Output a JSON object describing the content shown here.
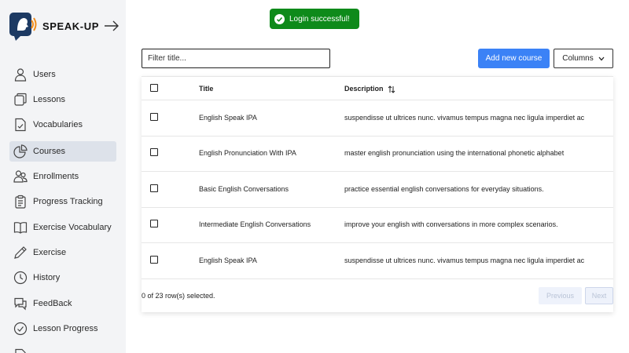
{
  "app": {
    "brand_name": "SPEAK-UP",
    "accent_color": "#3b82f6",
    "toast_color": "#0e8a1a"
  },
  "sidebar": {
    "items": [
      {
        "label": "Users",
        "icon": "user-icon"
      },
      {
        "label": "Lessons",
        "icon": "lessons-icon"
      },
      {
        "label": "Vocabularies",
        "icon": "document-check-icon"
      },
      {
        "label": "Courses",
        "icon": "pie-chart-icon",
        "active": true
      },
      {
        "label": "Enrollments",
        "icon": "users-icon"
      },
      {
        "label": "Progress Tracking",
        "icon": "clipboard-icon"
      },
      {
        "label": "Exercise Vocabulary",
        "icon": "book-icon"
      },
      {
        "label": "Exercise",
        "icon": "pencil-icon"
      },
      {
        "label": "History",
        "icon": "clock-icon"
      },
      {
        "label": "FeedBack",
        "icon": "chat-icon"
      },
      {
        "label": "Lesson Progress",
        "icon": "check-circle-icon"
      }
    ]
  },
  "toast": {
    "message": "Login successful!",
    "icon": "check-circle-icon"
  },
  "toolbar": {
    "filter_placeholder": "Filter title...",
    "filter_value": "",
    "add_label": "Add new course",
    "columns_label": "Columns"
  },
  "table": {
    "columns": [
      "Title",
      "Description"
    ],
    "rows": [
      {
        "title": "English Speak IPA",
        "description": "suspendisse ut ultrices nunc. vivamus tempus magna nec ligula imperdiet ac"
      },
      {
        "title": "English Pronunciation With IPA",
        "description": "master english pronunciation using the international phonetic alphabet"
      },
      {
        "title": "Basic English Conversations",
        "description": "practice essential english conversations for everyday situations."
      },
      {
        "title": "Intermediate English Conversations",
        "description": "improve your english with conversations in more complex scenarios."
      },
      {
        "title": "English Speak IPA",
        "description": "suspendisse ut ultrices nunc. vivamus tempus magna nec ligula imperdiet ac"
      }
    ]
  },
  "pagination": {
    "selection_text": "0 of 23 row(s) selected.",
    "previous_label": "Previous",
    "next_label": "Next"
  }
}
